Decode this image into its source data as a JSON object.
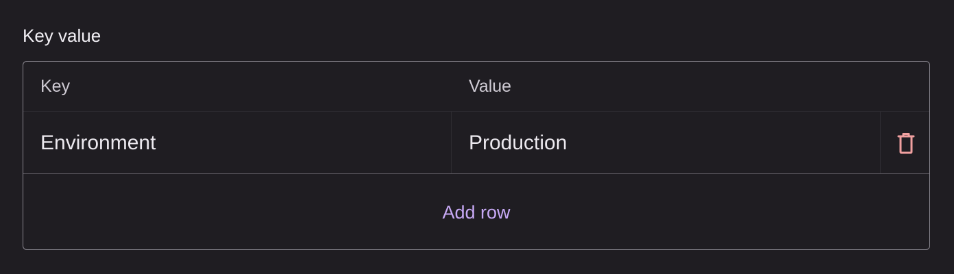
{
  "field": {
    "label": "Key value"
  },
  "table": {
    "columns": [
      "Key",
      "Value"
    ],
    "rows": [
      {
        "key": "Environment",
        "value": "Production"
      }
    ],
    "add_row_label": "Add row"
  },
  "icons": {
    "delete": "trash-icon"
  },
  "colors": {
    "background": "#1f1d22",
    "accent": "#c7a9f5",
    "danger": "#f0a0a0",
    "border": "#8a8790"
  }
}
